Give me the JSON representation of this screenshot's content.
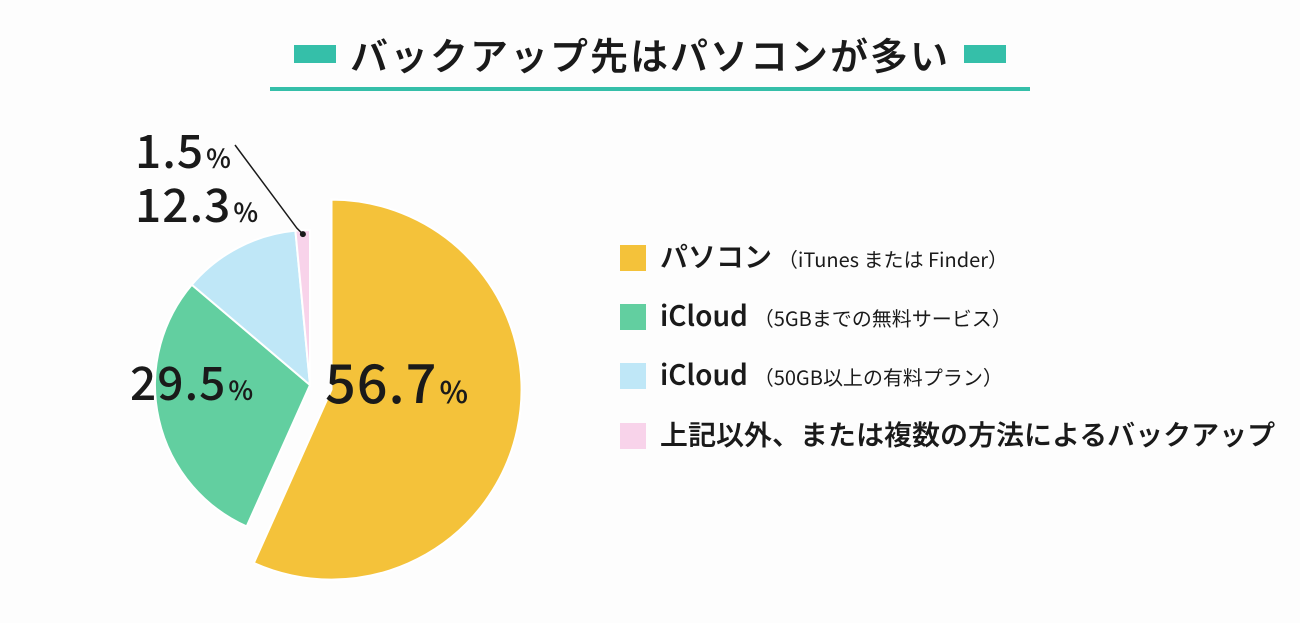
{
  "title": "バックアップ先はパソコンが多い",
  "accent": "#35bfa9",
  "chart_data": {
    "type": "pie",
    "title": "バックアップ先はパソコンが多い",
    "series": [
      {
        "name": "パソコン",
        "sub": "（iTunes または Finder）",
        "value": 56.7,
        "label": "56.7",
        "color": "#f4c23a",
        "exploded": true
      },
      {
        "name": "iCloud",
        "sub": "（5GBまでの無料サービス）",
        "value": 29.5,
        "label": "29.5",
        "color": "#62cfa0",
        "exploded": false
      },
      {
        "name": "iCloud",
        "sub": "（50GB以上の有料プラン）",
        "value": 12.3,
        "label": "12.3",
        "color": "#bfe7f7",
        "exploded": false
      },
      {
        "name": "上記以外、または複数の方法によるバックアップ",
        "sub": "",
        "value": 1.5,
        "label": "1.5",
        "color": "#f8d3ea",
        "exploded": false
      }
    ]
  },
  "percent_symbol": "%"
}
